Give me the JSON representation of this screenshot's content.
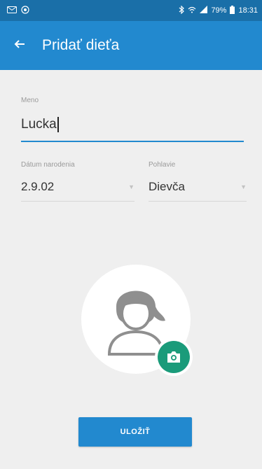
{
  "status_bar": {
    "battery": "79%",
    "time": "18:31",
    "icons": [
      "message-icon",
      "location-icon",
      "bluetooth-icon",
      "wifi-icon",
      "signal-icon",
      "battery-icon"
    ]
  },
  "app_bar": {
    "title": "Pridať dieťa",
    "back_icon": "arrow-left-icon"
  },
  "form": {
    "name": {
      "label": "Meno",
      "value": "Lucka"
    },
    "birth_date": {
      "label": "Dátum narodenia",
      "value": "2.9.02"
    },
    "gender": {
      "label": "Pohlavie",
      "value": "Dievča"
    },
    "avatar_icon": "child-avatar-icon",
    "camera_icon": "camera-icon",
    "save_label": "ULOŽIŤ"
  },
  "colors": {
    "status_bar": "#1a6fa8",
    "app_bar": "#2289cf",
    "accent": "#2289cf",
    "camera_button": "#1a9b7a",
    "background": "#efefef"
  }
}
